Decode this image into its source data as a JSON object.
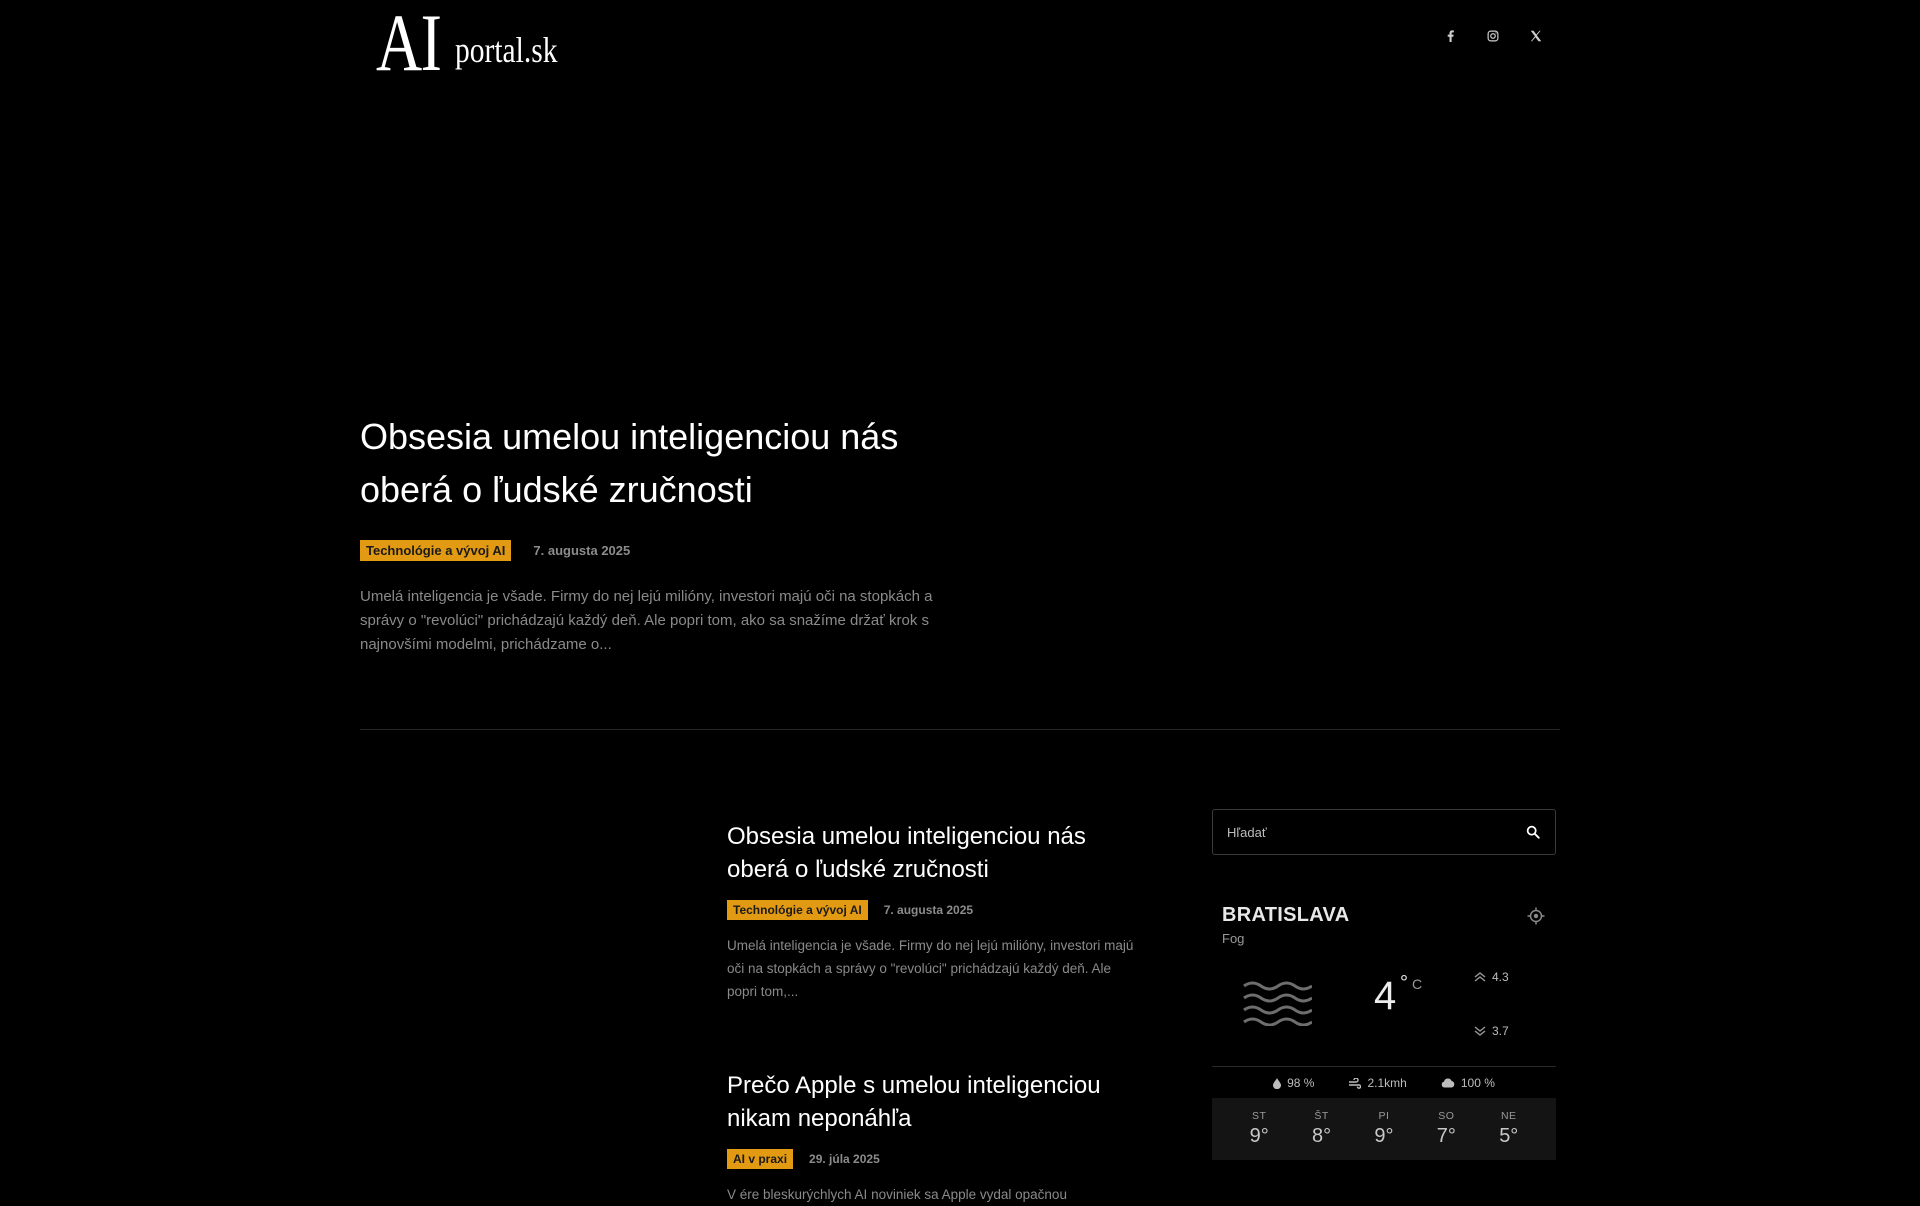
{
  "header": {
    "logo_ai": "AI",
    "logo_portal": "portal.sk",
    "social": [
      {
        "name": "facebook-icon",
        "glyph": "f"
      },
      {
        "name": "instagram-icon",
        "glyph": "instagram"
      },
      {
        "name": "x-icon",
        "glyph": "x"
      }
    ]
  },
  "hero": {
    "title": "Obsesia umelou inteligenciou nás oberá o ľudské zručnosti",
    "category": "Technológie a vývoj AI",
    "date": "7. augusta 2025",
    "excerpt": "Umelá inteligencia je všade. Firmy do nej lejú milióny, investori majú oči na stopkách a správy o \"revolúci\" prichádzajú každý deň. Ale popri tom, ako sa snažíme držať krok s najnovšími modelmi, prichádzame o..."
  },
  "articles": [
    {
      "title": "Obsesia umelou inteligenciou nás oberá o ľudské zručnosti",
      "category": "Technológie a vývoj AI",
      "date": "7. augusta 2025",
      "excerpt": "Umelá inteligencia je všade. Firmy do nej lejú milióny, investori majú oči na stopkách a správy o \"revolúci\" prichádzajú každý deň. Ale popri tom,..."
    },
    {
      "title": "Prečo Apple s umelou inteligenciou nikam neponáhľa",
      "category": "AI v praxi",
      "date": "29. júla 2025",
      "excerpt": "V ére bleskurýchlych AI noviniek sa Apple vydal opačnou"
    }
  ],
  "sidebar": {
    "search_placeholder": "Hľadať"
  },
  "weather": {
    "city": "BRATISLAVA",
    "condition": "Fog",
    "temp": "4",
    "deg": "°",
    "unit": "C",
    "high": "4.3",
    "low": "3.7",
    "humidity": "98 %",
    "wind": "2.1kmh",
    "clouds": "100 %",
    "forecast": [
      {
        "day": "ST",
        "temp": "9°"
      },
      {
        "day": "ŠT",
        "temp": "8°"
      },
      {
        "day": "PI",
        "temp": "9°"
      },
      {
        "day": "SO",
        "temp": "7°"
      },
      {
        "day": "NE",
        "temp": "5°"
      }
    ]
  },
  "colors": {
    "background": "#000000",
    "accent": "#e29a12",
    "muted_text": "#8a8a8a"
  }
}
